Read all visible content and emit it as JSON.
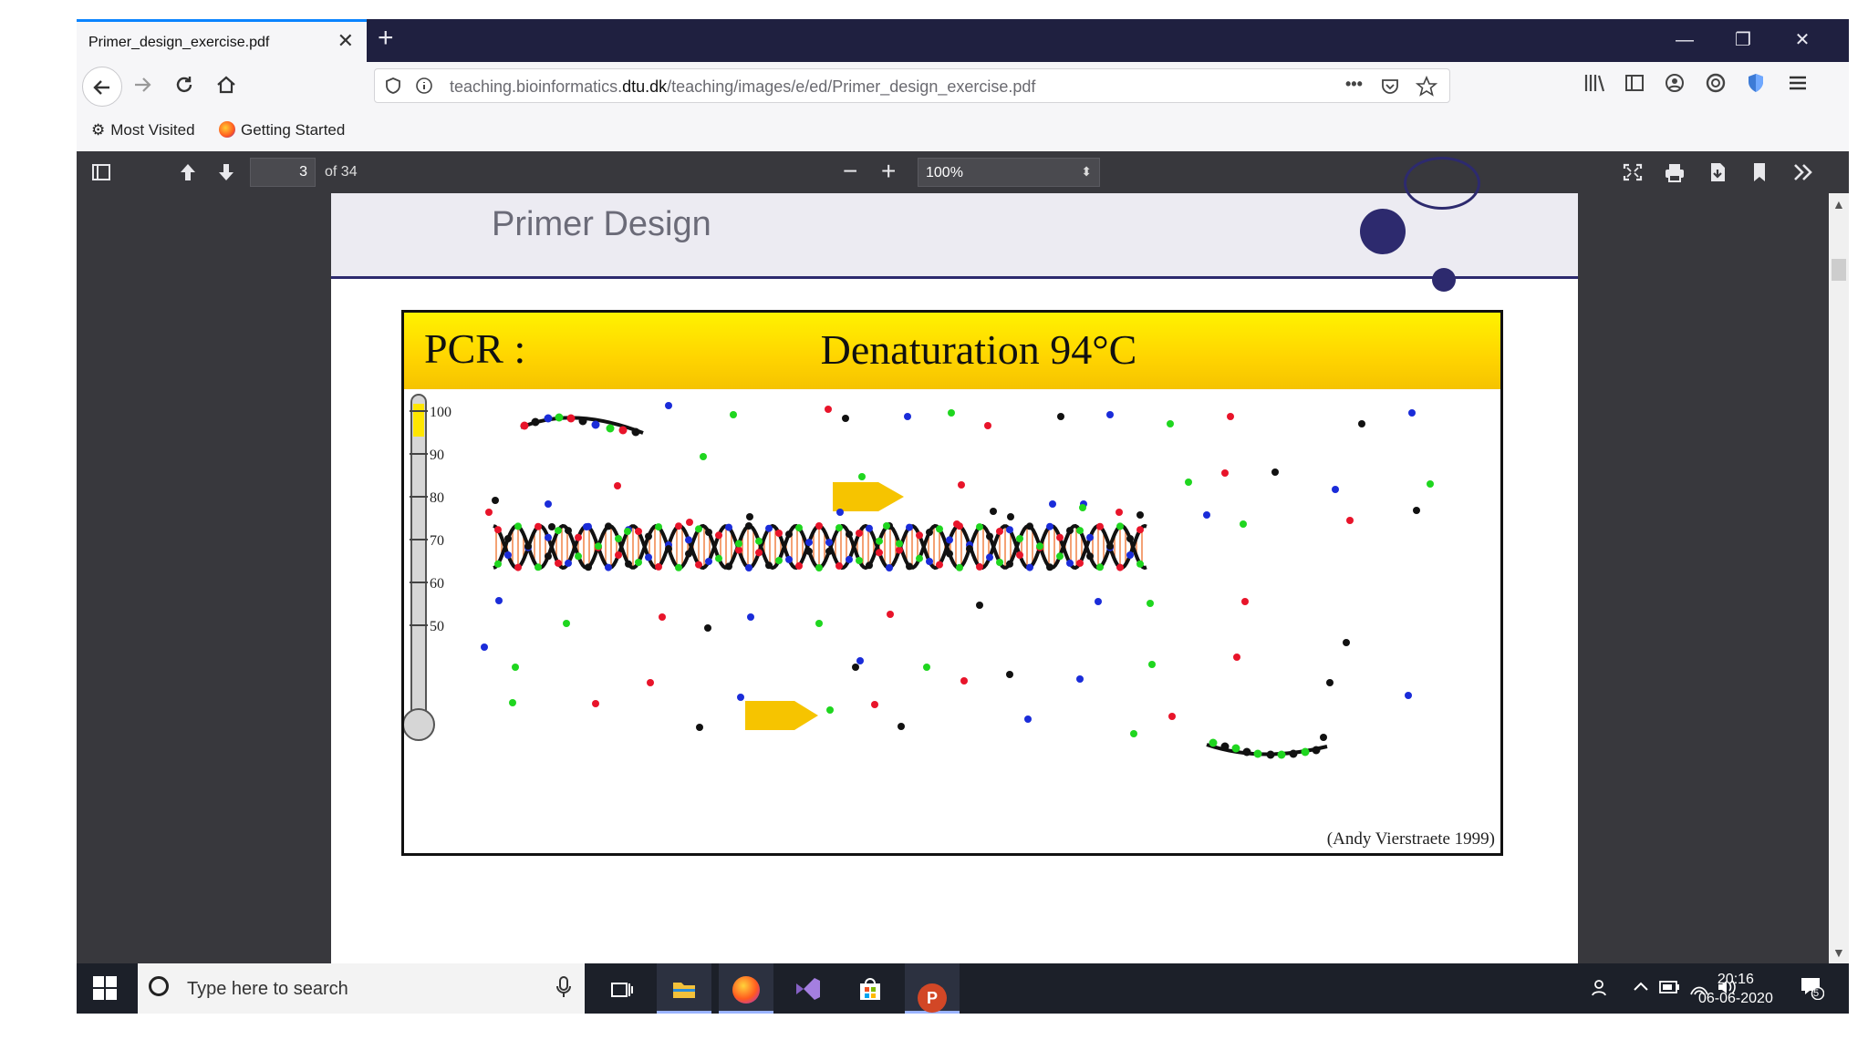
{
  "browser": {
    "tab_title": "Primer_design_exercise.pdf",
    "tab_close": "✕",
    "new_tab": "+",
    "url_prefix": "teaching.bioinformatics.",
    "url_host": "dtu.dk",
    "url_path": "/teaching/images/e/ed/Primer_design_exercise.pdf",
    "url_more": "•••",
    "bookmarks": [
      {
        "label": "Most Visited",
        "icon": "gear-icon"
      },
      {
        "label": "Getting Started",
        "icon": "firefox-icon"
      }
    ],
    "window_controls": {
      "minimize": "—",
      "restore": "❐",
      "close": "✕"
    }
  },
  "pdf_toolbar": {
    "page_number": "3",
    "page_count": "of 34",
    "zoom_out": "−",
    "zoom_in": "+",
    "zoom": "100%",
    "zoom_caret": "⬍"
  },
  "pdf_page": {
    "header_title": "Primer Design",
    "slide": {
      "label": "PCR :",
      "title": "Denaturation 94°C",
      "credit": "(Andy Vierstraete 1999)",
      "thermometer_ticks": [
        "100",
        "90",
        "80",
        "70",
        "60",
        "50"
      ],
      "colors": {
        "banner_top": "#fff200",
        "banner_bottom": "#f5c300",
        "thermometer_fill": "#ffe600",
        "nucleotide_red": "#e8142a",
        "nucleotide_green": "#1fd61f",
        "nucleotide_blue": "#1a2cd9",
        "nucleotide_black": "#111111",
        "strand_rungs": "#f28a52",
        "primer_yellow": "#f6c400"
      }
    }
  },
  "taskbar": {
    "search_placeholder": "Type here to search",
    "time": "20:16",
    "date": "06-06-2020",
    "notification_count": "5"
  }
}
